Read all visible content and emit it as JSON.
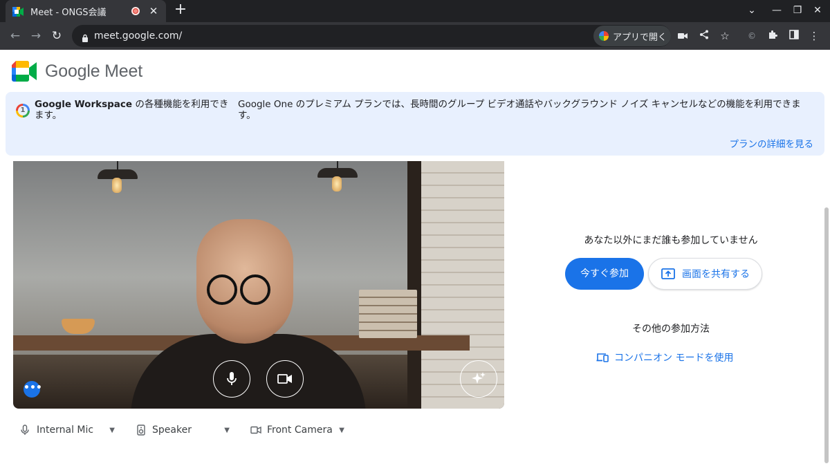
{
  "browser": {
    "tab_title": "Meet - ONGS会議",
    "url": "meet.google.com/",
    "open_app_label": "アプリで開く"
  },
  "brand": {
    "name": "Google Meet"
  },
  "banner": {
    "left_bold": "Google Workspace",
    "left_rest": " の各種機能を利用できます。",
    "right_text": "Google One のプレミアム プランでは、長時間のグループ ビデオ通話やバックグラウンド ノイズ キャンセルなどの機能を利用できます。",
    "link": "プランの詳細を見る"
  },
  "devices": {
    "mic": "Internal Mic",
    "speaker": "Speaker",
    "camera": "Front Camera"
  },
  "join_panel": {
    "status": "あなた以外にまだ誰も参加していません",
    "join_now": "今すぐ参加",
    "present": "画面を共有する",
    "other_ways": "その他の参加方法",
    "companion": "コンパニオン モードを使用"
  },
  "colors": {
    "accent": "#1a73e8",
    "banner_bg": "#e8f0fe",
    "chrome_dark": "#202124",
    "chrome_toolbar": "#35363a"
  }
}
